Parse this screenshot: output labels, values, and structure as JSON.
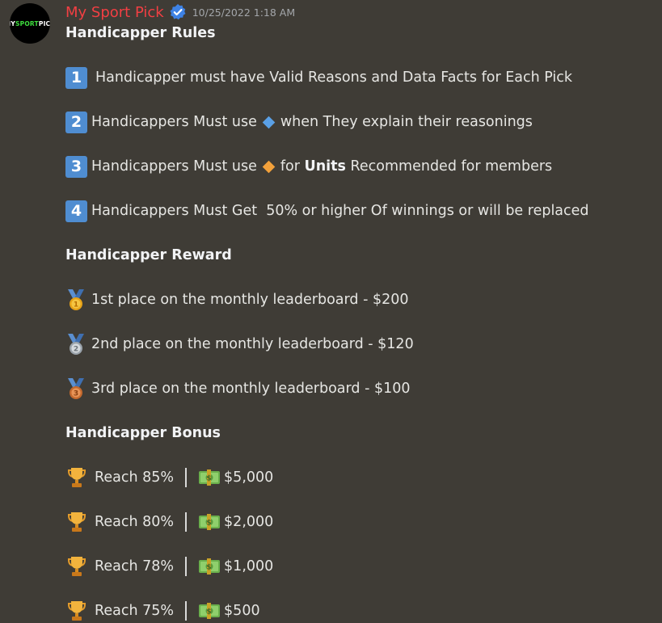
{
  "author": {
    "name": "My Sport Pick",
    "timestamp": "10/25/2022 1:18 AM",
    "avatar_logo": {
      "part1": "MY",
      "part2": "SPORT",
      "part3": "PICK"
    }
  },
  "rules": {
    "heading": "Handicapper Rules",
    "items": [
      {
        "num": "1",
        "text": "Handicapper must have Valid Reasons and Data Facts for Each Pick"
      },
      {
        "num": "2",
        "before": "Handicappers Must use",
        "after": "when They explain their reasonings"
      },
      {
        "num": "3",
        "before": "Handicappers Must use",
        "mid": "for",
        "bold": "Units",
        "after": "Recommended for members"
      },
      {
        "num": "4",
        "text": "Handicappers Must Get  50% or higher Of winnings or will be replaced"
      }
    ]
  },
  "reward": {
    "heading": "Handicapper Reward",
    "items": [
      {
        "medal": "1",
        "text": "1st place on the monthly leaderboard - $200"
      },
      {
        "medal": "2",
        "text": "2nd place on the monthly leaderboard - $120"
      },
      {
        "medal": "3",
        "text": "3rd place on the monthly leaderboard - $100"
      }
    ]
  },
  "bonus": {
    "heading": "Handicapper Bonus",
    "items": [
      {
        "reach": "Reach 85%",
        "amount": "$5,000"
      },
      {
        "reach": "Reach 80%",
        "amount": "$2,000"
      },
      {
        "reach": "Reach 78%",
        "amount": "$1,000"
      },
      {
        "reach": "Reach 75%",
        "amount": "$500"
      }
    ]
  },
  "icons": {
    "keycap": "keycap-digit-icon",
    "blue_diamond": "small-blue-diamond-icon",
    "orange_diamond": "small-orange-diamond-icon",
    "medal": "sports-medal-icon",
    "trophy": "trophy-icon",
    "money": "dollar-banknote-icon",
    "verified": "verified-badge-icon"
  },
  "colors": {
    "background": "#3f3c36",
    "username": "#f23f43",
    "keycap": "#4f8dd1",
    "verified": "#3e82e5",
    "blue_diamond": "#5aa0e6",
    "orange_diamond": "#f2a13b"
  }
}
